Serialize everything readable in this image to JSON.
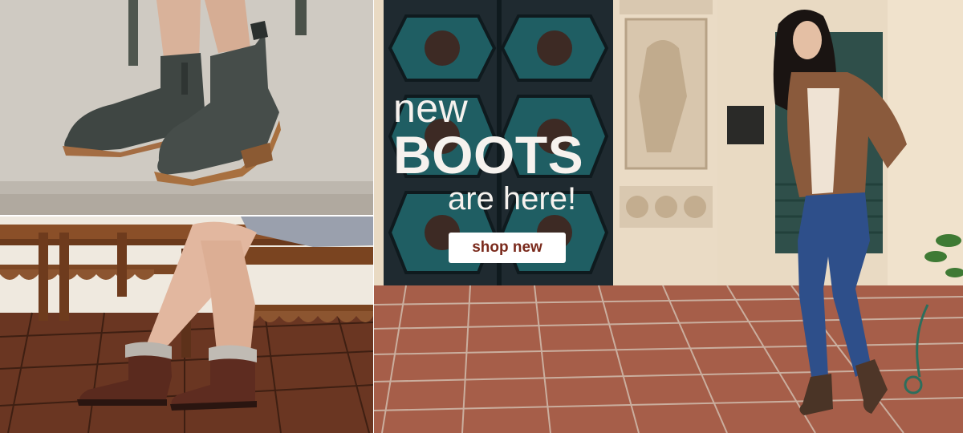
{
  "banner": {
    "headline_line1": "new",
    "headline_line2": "BOOTS",
    "headline_line3": "are here!",
    "cta_label": "shop new"
  },
  "images": {
    "top_left": "grey-suede-ankle-booties-photo",
    "bottom_left": "brown-shearling-cuff-boots-photo",
    "main": "model-in-leather-jacket-and-boots-photo"
  },
  "colors": {
    "headline_text": "#f6f2ee",
    "cta_background": "#ffffff",
    "cta_text": "#7a2a1c",
    "door_teal": "#1f5e63",
    "floor_tile": "#a65e49",
    "wall_cream": "#e9dac3"
  }
}
